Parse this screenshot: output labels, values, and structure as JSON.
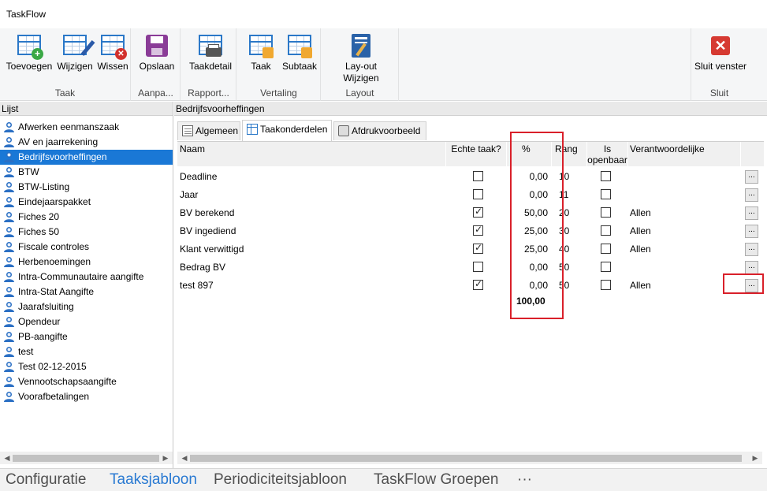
{
  "app": {
    "title": "TaskFlow"
  },
  "ribbon": {
    "groups": [
      {
        "name": "Taak",
        "buttons": [
          "Toevoegen",
          "Wijzigen",
          "Wissen"
        ]
      },
      {
        "name": "Aanpa...",
        "buttons": [
          "Opslaan"
        ]
      },
      {
        "name": "Rapport...",
        "buttons": [
          "Taakdetail"
        ]
      },
      {
        "name": "Vertaling",
        "buttons": [
          "Taak",
          "Subtaak"
        ]
      },
      {
        "name": "Layout",
        "buttons": [
          "Lay-out",
          "Wijzigen"
        ]
      },
      {
        "name": "Sluit",
        "buttons": [
          "Sluit venster"
        ]
      }
    ]
  },
  "left": {
    "header": "Lijst",
    "items": [
      "Afwerken eenmanszaak",
      "AV en jaarrekening",
      "Bedrijfsvoorheffingen",
      "BTW",
      "BTW-Listing",
      "Eindejaarspakket",
      "Fiches 20",
      "Fiches 50",
      "Fiscale controles",
      "Herbenoemingen",
      "Intra-Communautaire aangifte",
      "Intra-Stat Aangifte",
      "Jaarafsluiting",
      "Opendeur",
      "PB-aangifte",
      "test",
      "Test 02-12-2015",
      "Vennootschapsaangifte",
      "Voorafbetalingen"
    ],
    "selected_index": 2
  },
  "right": {
    "header": "Bedrijfsvoorheffingen",
    "tabs": [
      "Algemeen",
      "Taakonderdelen",
      "Afdrukvoorbeeld"
    ],
    "active_tab": 1,
    "columns": {
      "naam": "Naam",
      "echte": "Echte taak?",
      "pct": "%",
      "rang": "Rang",
      "open1": "Is",
      "open2": "openbaar",
      "verantw": "Verantwoordelijke"
    },
    "rows": [
      {
        "naam": "Deadline",
        "echte": false,
        "pct": "0,00",
        "rang": "10",
        "open": false,
        "verantw": ""
      },
      {
        "naam": "Jaar",
        "echte": false,
        "pct": "0,00",
        "rang": "11",
        "open": false,
        "verantw": ""
      },
      {
        "naam": "BV berekend",
        "echte": true,
        "pct": "50,00",
        "rang": "20",
        "open": false,
        "verantw": "Allen"
      },
      {
        "naam": "BV ingediend",
        "echte": true,
        "pct": "25,00",
        "rang": "30",
        "open": false,
        "verantw": "Allen"
      },
      {
        "naam": "Klant verwittigd",
        "echte": true,
        "pct": "25,00",
        "rang": "40",
        "open": false,
        "verantw": "Allen"
      },
      {
        "naam": "Bedrag BV",
        "echte": false,
        "pct": "0,00",
        "rang": "50",
        "open": false,
        "verantw": ""
      },
      {
        "naam": "test 897",
        "echte": true,
        "pct": "0,00",
        "rang": "50",
        "open": false,
        "verantw": "Allen"
      }
    ],
    "total": "100,00",
    "ellipsis": "..."
  },
  "bottom_tabs": [
    "Configuratie",
    "Taaksjabloon",
    "Periodiciteitsjabloon",
    "TaskFlow Groepen",
    "···"
  ],
  "bottom_active": 1,
  "colors": {
    "selection": "#1a78d6",
    "highlight": "#d9202a",
    "accent": "#2a7ad2"
  }
}
